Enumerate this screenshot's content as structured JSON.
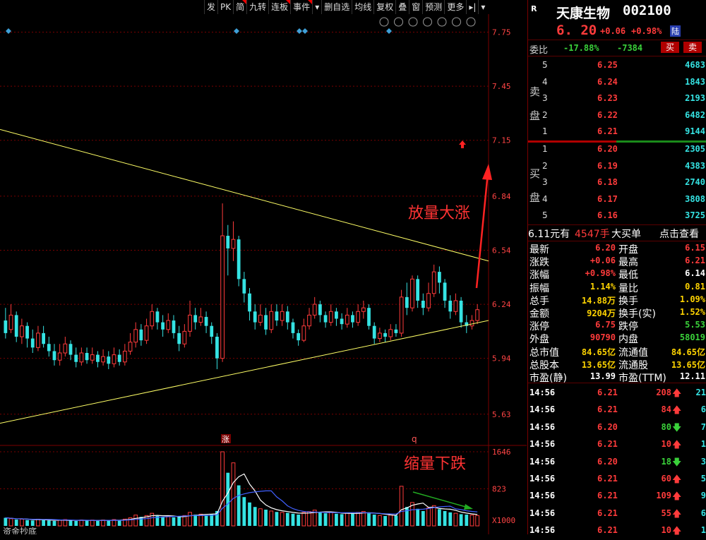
{
  "toolbar": {
    "items": [
      {
        "label": "发",
        "flag": false
      },
      {
        "label": "PK",
        "flag": false
      },
      {
        "label": "简",
        "flag": true
      },
      {
        "label": "九转",
        "flag": false
      },
      {
        "label": "连板",
        "flag": true
      },
      {
        "label": "事件",
        "flag": true
      },
      {
        "label": "▾",
        "flag": false
      },
      {
        "label": "删自选",
        "flag": false
      },
      {
        "label": "均线",
        "flag": false
      },
      {
        "label": "复权",
        "flag": false
      },
      {
        "label": "叠",
        "flag": false
      },
      {
        "label": "窗",
        "flag": false
      },
      {
        "label": "预测",
        "flag": false
      },
      {
        "label": "更多",
        "flag": false
      },
      {
        "label": "▸|",
        "flag": false
      },
      {
        "label": "▾",
        "flag": false
      }
    ],
    "tool_icons": [
      "settings-icon",
      "pen-icon",
      "screenshot-icon",
      "pan-hand-icon",
      "zoom-box-icon",
      "zoom-in-icon",
      "zoom-out-icon"
    ]
  },
  "price_axis": {
    "ticks": [
      "7.75",
      "7.45",
      "7.15",
      "6.84",
      "6.54",
      "6.24",
      "5.94",
      "5.63"
    ]
  },
  "volume_axis": {
    "ticks": [
      "1646",
      "823",
      "X1000"
    ]
  },
  "annotations": {
    "up_label": "放量大涨",
    "down_label": "缩量下跌",
    "limit_up_marker": "涨",
    "q_marker": "q",
    "bottom_tab": "资金抄底"
  },
  "colors": {
    "up": "#ff3b3b",
    "down": "#35e3e3",
    "trend": "#ffff66",
    "grid": "#7a0000",
    "ma1": "#ffffff",
    "ma2": "#4060ff",
    "arrow_green": "#22aa22"
  },
  "chart_data": {
    "type": "candlestick",
    "ylim": [
      5.5,
      7.85
    ],
    "vlim": [
      0,
      1646
    ],
    "candles": [
      [
        6.15,
        6.08,
        6.22,
        6.05,
        "d"
      ],
      [
        6.1,
        6.18,
        6.24,
        6.08,
        "u"
      ],
      [
        6.18,
        6.06,
        6.2,
        6.03,
        "d"
      ],
      [
        6.06,
        6.12,
        6.16,
        6.02,
        "u"
      ],
      [
        6.12,
        6.05,
        6.14,
        6.0,
        "d"
      ],
      [
        6.05,
        6.0,
        6.1,
        5.97,
        "d"
      ],
      [
        6.0,
        6.08,
        6.12,
        5.98,
        "u"
      ],
      [
        6.08,
        6.02,
        6.12,
        6.0,
        "d"
      ],
      [
        6.02,
        5.98,
        6.06,
        5.95,
        "d"
      ],
      [
        5.98,
        5.93,
        6.02,
        5.9,
        "d"
      ],
      [
        5.93,
        5.97,
        6.02,
        5.9,
        "u"
      ],
      [
        5.97,
        6.02,
        6.06,
        5.95,
        "u"
      ],
      [
        6.02,
        5.96,
        6.04,
        5.93,
        "d"
      ],
      [
        5.96,
        5.92,
        6.0,
        5.89,
        "d"
      ],
      [
        5.92,
        5.97,
        6.0,
        5.9,
        "u"
      ],
      [
        5.97,
        5.93,
        6.0,
        5.91,
        "d"
      ],
      [
        5.93,
        5.96,
        6.0,
        5.91,
        "u"
      ],
      [
        5.96,
        5.92,
        5.98,
        5.89,
        "d"
      ],
      [
        5.92,
        5.95,
        5.99,
        5.9,
        "u"
      ],
      [
        5.95,
        5.91,
        5.98,
        5.88,
        "d"
      ],
      [
        5.91,
        5.96,
        6.0,
        5.89,
        "u"
      ],
      [
        5.96,
        5.92,
        5.99,
        5.9,
        "d"
      ],
      [
        5.92,
        5.98,
        6.02,
        5.9,
        "u"
      ],
      [
        5.98,
        6.03,
        6.08,
        5.96,
        "u"
      ],
      [
        6.03,
        6.1,
        6.14,
        6.0,
        "u"
      ],
      [
        6.1,
        6.04,
        6.13,
        6.01,
        "d"
      ],
      [
        6.04,
        6.12,
        6.16,
        6.02,
        "u"
      ],
      [
        6.12,
        6.2,
        6.24,
        6.1,
        "u"
      ],
      [
        6.2,
        6.14,
        6.22,
        6.1,
        "d"
      ],
      [
        6.14,
        6.1,
        6.18,
        6.06,
        "d"
      ],
      [
        6.1,
        6.15,
        6.19,
        6.08,
        "u"
      ],
      [
        6.15,
        6.08,
        6.18,
        6.05,
        "d"
      ],
      [
        6.08,
        6.02,
        6.12,
        5.98,
        "d"
      ],
      [
        6.02,
        6.09,
        6.13,
        6.0,
        "u"
      ],
      [
        6.09,
        6.18,
        6.26,
        6.06,
        "u"
      ],
      [
        6.18,
        6.14,
        6.22,
        6.1,
        "d"
      ],
      [
        6.14,
        6.17,
        6.22,
        6.12,
        "u"
      ],
      [
        6.17,
        6.12,
        6.2,
        6.08,
        "d"
      ],
      [
        6.12,
        6.06,
        6.14,
        6.02,
        "d"
      ],
      [
        6.06,
        5.94,
        6.08,
        5.88,
        "d"
      ],
      [
        5.94,
        6.62,
        6.8,
        5.92,
        "u"
      ],
      [
        6.62,
        6.55,
        6.68,
        6.4,
        "d"
      ],
      [
        6.55,
        6.6,
        6.7,
        6.48,
        "u"
      ],
      [
        6.6,
        6.38,
        6.62,
        6.34,
        "d"
      ],
      [
        6.38,
        6.3,
        6.42,
        6.25,
        "d"
      ],
      [
        6.3,
        6.2,
        6.33,
        6.15,
        "d"
      ],
      [
        6.2,
        6.14,
        6.24,
        6.1,
        "d"
      ],
      [
        6.14,
        6.18,
        6.24,
        6.12,
        "u"
      ],
      [
        6.18,
        6.1,
        6.22,
        6.07,
        "d"
      ],
      [
        6.1,
        6.2,
        6.24,
        6.08,
        "u"
      ],
      [
        6.2,
        6.15,
        6.24,
        6.12,
        "d"
      ],
      [
        6.15,
        6.2,
        6.24,
        6.12,
        "u"
      ],
      [
        6.2,
        6.14,
        6.23,
        6.1,
        "d"
      ],
      [
        6.14,
        6.08,
        6.16,
        6.05,
        "d"
      ],
      [
        6.08,
        6.04,
        6.1,
        6.01,
        "d"
      ],
      [
        6.04,
        6.12,
        6.16,
        6.03,
        "u"
      ],
      [
        6.12,
        6.18,
        6.22,
        6.1,
        "u"
      ],
      [
        6.18,
        6.24,
        6.28,
        6.16,
        "u"
      ],
      [
        6.24,
        6.18,
        6.26,
        6.14,
        "d"
      ],
      [
        6.18,
        6.14,
        6.2,
        6.11,
        "d"
      ],
      [
        6.14,
        6.2,
        6.24,
        6.12,
        "u"
      ],
      [
        6.2,
        6.16,
        6.22,
        6.12,
        "d"
      ],
      [
        6.16,
        6.13,
        6.19,
        6.1,
        "d"
      ],
      [
        6.13,
        6.18,
        6.22,
        6.11,
        "u"
      ],
      [
        6.18,
        6.14,
        6.2,
        6.11,
        "d"
      ],
      [
        6.14,
        6.2,
        6.24,
        6.12,
        "u"
      ],
      [
        6.2,
        6.22,
        6.26,
        6.16,
        "u"
      ],
      [
        6.22,
        6.12,
        6.24,
        6.1,
        "d"
      ],
      [
        6.12,
        6.05,
        6.14,
        6.02,
        "d"
      ],
      [
        6.05,
        6.08,
        6.11,
        6.03,
        "u"
      ],
      [
        6.08,
        6.06,
        6.1,
        6.03,
        "d"
      ],
      [
        6.06,
        6.1,
        6.13,
        6.04,
        "u"
      ],
      [
        6.1,
        6.08,
        6.13,
        6.06,
        "d"
      ],
      [
        6.08,
        6.28,
        6.32,
        6.06,
        "u"
      ],
      [
        6.28,
        6.22,
        6.36,
        6.18,
        "d"
      ],
      [
        6.22,
        6.38,
        6.4,
        6.2,
        "u"
      ],
      [
        6.38,
        6.26,
        6.4,
        6.22,
        "d"
      ],
      [
        6.26,
        6.22,
        6.3,
        6.18,
        "d"
      ],
      [
        6.22,
        6.3,
        6.36,
        6.2,
        "u"
      ],
      [
        6.3,
        6.42,
        6.46,
        6.28,
        "u"
      ],
      [
        6.42,
        6.36,
        6.45,
        6.3,
        "d"
      ],
      [
        6.36,
        6.26,
        6.38,
        6.22,
        "d"
      ],
      [
        6.26,
        6.2,
        6.29,
        6.16,
        "d"
      ],
      [
        6.2,
        6.26,
        6.3,
        6.18,
        "u"
      ],
      [
        6.26,
        6.14,
        6.28,
        6.11,
        "d"
      ],
      [
        6.14,
        6.12,
        6.18,
        6.08,
        "d"
      ],
      [
        6.12,
        6.15,
        6.18,
        6.1,
        "u"
      ],
      [
        6.15,
        6.21,
        6.24,
        6.13,
        "u"
      ]
    ],
    "volumes": [
      180,
      160,
      140,
      150,
      130,
      120,
      150,
      130,
      120,
      110,
      130,
      140,
      120,
      110,
      130,
      120,
      130,
      110,
      130,
      120,
      140,
      130,
      150,
      180,
      240,
      200,
      230,
      280,
      220,
      200,
      210,
      190,
      200,
      230,
      300,
      250,
      260,
      240,
      260,
      330,
      1646,
      1180,
      1400,
      900,
      640,
      520,
      420,
      380,
      360,
      330,
      310,
      300,
      290,
      270,
      250,
      300,
      320,
      350,
      310,
      280,
      300,
      270,
      260,
      290,
      270,
      300,
      320,
      280,
      250,
      230,
      220,
      240,
      230,
      880,
      420,
      520,
      380,
      330,
      400,
      450,
      370,
      330,
      300,
      280,
      260,
      250,
      240,
      230
    ]
  },
  "stock": {
    "badge": "R",
    "name": "天康生物",
    "code": "002100",
    "price": "6. 20",
    "change": "+0.06",
    "change_pct": "+0.98%",
    "market_tag": "陆"
  },
  "weibi": {
    "label": "委比",
    "pct": "-17.88%",
    "diff": "-7384",
    "buy_btn": "买",
    "sell_btn": "卖"
  },
  "sell_side": {
    "label_top": "卖",
    "label_bottom": "盘",
    "levels": [
      {
        "n": "5",
        "price": "6.25",
        "vol": "4683"
      },
      {
        "n": "4",
        "price": "6.24",
        "vol": "1843"
      },
      {
        "n": "3",
        "price": "6.23",
        "vol": "2193"
      },
      {
        "n": "2",
        "price": "6.22",
        "vol": "6482"
      },
      {
        "n": "1",
        "price": "6.21",
        "vol": "9144"
      }
    ]
  },
  "buy_side": {
    "label_top": "买",
    "label_bottom": "盘",
    "levels": [
      {
        "n": "1",
        "price": "6.20",
        "vol": "2305"
      },
      {
        "n": "2",
        "price": "6.19",
        "vol": "4383"
      },
      {
        "n": "3",
        "price": "6.18",
        "vol": "2740"
      },
      {
        "n": "4",
        "price": "6.17",
        "vol": "3808"
      },
      {
        "n": "5",
        "price": "6.16",
        "vol": "3725"
      }
    ]
  },
  "big_order": {
    "price": "6.11元有",
    "qty": "4547手",
    "label": "大买单",
    "link": "点击查看"
  },
  "stats": [
    {
      "l1": "最新",
      "v1": "6.20",
      "c1": "red",
      "l2": "开盘",
      "v2": "6.15",
      "c2": "red"
    },
    {
      "l1": "涨跌",
      "v1": "+0.06",
      "c1": "red",
      "l2": "最高",
      "v2": "6.21",
      "c2": "red"
    },
    {
      "l1": "涨幅",
      "v1": "+0.98%",
      "c1": "red",
      "l2": "最低",
      "v2": "6.14",
      "c2": "white"
    },
    {
      "l1": "振幅",
      "v1": "1.14%",
      "c1": "yellow",
      "l2": "量比",
      "v2": "0.81",
      "c2": "yellow"
    },
    {
      "l1": "总手",
      "v1": "14.88万",
      "c1": "yellow",
      "l2": "换手",
      "v2": "1.09%",
      "c2": "yellow"
    },
    {
      "l1": "金额",
      "v1": "9204万",
      "c1": "yellow",
      "l2": "换手(实)",
      "v2": "1.52%",
      "c2": "yellow"
    },
    {
      "l1": "涨停",
      "v1": "6.75",
      "c1": "red",
      "l2": "跌停",
      "v2": "5.53",
      "c2": "green"
    },
    {
      "l1": "外盘",
      "v1": "90790",
      "c1": "red",
      "l2": "内盘",
      "v2": "58019",
      "c2": "green"
    },
    {
      "l1": "总市值",
      "v1": "84.65亿",
      "c1": "yellow",
      "l2": "流通值",
      "v2": "84.65亿",
      "c2": "yellow"
    },
    {
      "l1": "总股本",
      "v1": "13.65亿",
      "c1": "yellow",
      "l2": "流通股",
      "v2": "13.65亿",
      "c2": "yellow"
    },
    {
      "l1": "市盈(静)",
      "v1": "13.99",
      "c1": "white",
      "l2": "市盈(TTM)",
      "v2": "12.11",
      "c2": "white"
    }
  ],
  "ticks": [
    {
      "time": "14:56",
      "price": "6.21",
      "pc": "red",
      "vol": "208",
      "dir": "up",
      "extra": "21"
    },
    {
      "time": "14:56",
      "price": "6.21",
      "pc": "red",
      "vol": "84",
      "dir": "up",
      "extra": "6"
    },
    {
      "time": "14:56",
      "price": "6.20",
      "pc": "red",
      "vol": "80",
      "dir": "down",
      "extra": "7"
    },
    {
      "time": "14:56",
      "price": "6.21",
      "pc": "red",
      "vol": "10",
      "dir": "up",
      "extra": "1"
    },
    {
      "time": "14:56",
      "price": "6.20",
      "pc": "red",
      "vol": "18",
      "dir": "down",
      "extra": "3"
    },
    {
      "time": "14:56",
      "price": "6.21",
      "pc": "red",
      "vol": "60",
      "dir": "up",
      "extra": "5"
    },
    {
      "time": "14:56",
      "price": "6.21",
      "pc": "red",
      "vol": "109",
      "dir": "up",
      "extra": "9"
    },
    {
      "time": "14:56",
      "price": "6.21",
      "pc": "red",
      "vol": "55",
      "dir": "up",
      "extra": "6"
    },
    {
      "time": "14:56",
      "price": "6.21",
      "pc": "red",
      "vol": "10",
      "dir": "up",
      "extra": "1"
    }
  ]
}
